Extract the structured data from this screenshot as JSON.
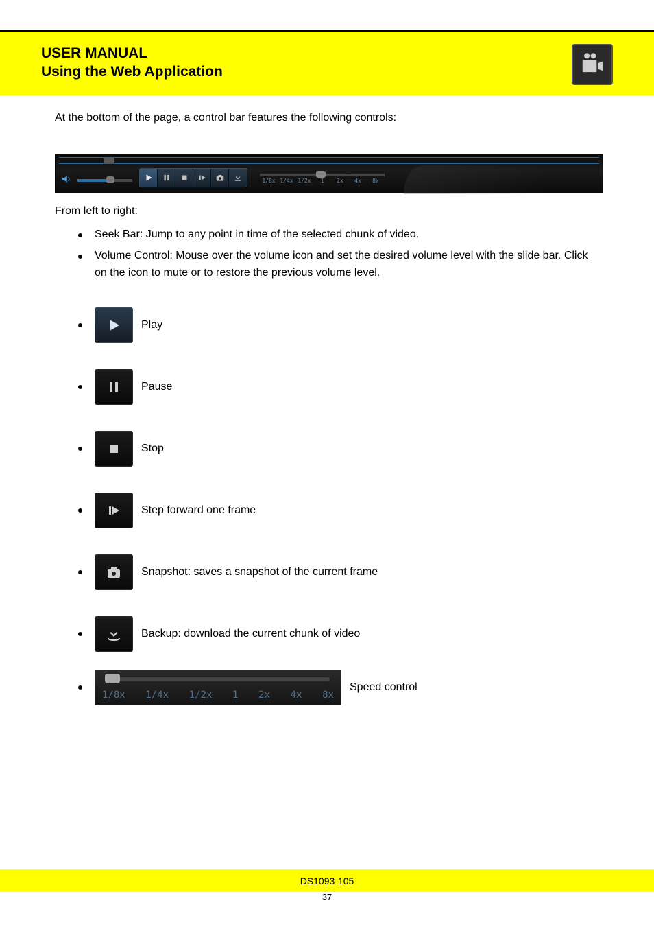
{
  "header": {
    "line1": "USER MANUAL",
    "line2": "Using the Web Application"
  },
  "intro": "At the bottom of the page, a control bar features the following controls:",
  "under_bar": "From left to right:",
  "bullets": {
    "seek": "Seek Bar: Jump to any point in time of the selected chunk of video.",
    "volume": "Volume Control: Mouse over the volume icon and set the desired volume level with the slide bar. Click on the icon to mute or to restore the previous volume level."
  },
  "icons": {
    "play": "Play",
    "pause": "Pause",
    "stop": "Stop",
    "step": "Step forward one frame",
    "snapshot": "Snapshot: saves a snapshot of the current frame",
    "download": "Backup: download the current chunk of video",
    "speed": "Speed control"
  },
  "speed_labels": [
    "1/8x",
    "1/4x",
    "1/2x",
    "1",
    "2x",
    "4x",
    "8x"
  ],
  "footer": {
    "main": "DS1093-105",
    "page": "37"
  }
}
